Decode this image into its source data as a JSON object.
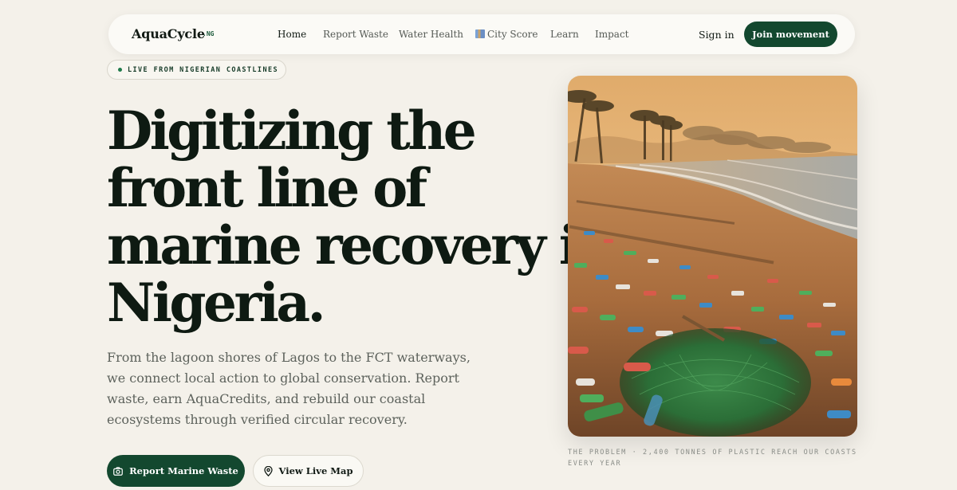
{
  "nav": {
    "logo": "AquaCycle",
    "logo_suffix": ".NG",
    "links": [
      {
        "label": "Home",
        "active": true
      },
      {
        "label": "Report Waste"
      },
      {
        "label": "Water Health"
      },
      {
        "label": "City Score",
        "icon": "cityscape-icon"
      },
      {
        "label": "Learn"
      },
      {
        "label": "Impact"
      }
    ],
    "signin": "Sign in",
    "cta": "Join movement"
  },
  "hero": {
    "badge": "LIVE FROM NIGERIAN COASTLINES",
    "headline": [
      "Digitizing the",
      "front line of",
      "marine recovery in",
      "Nigeria."
    ],
    "description": "From the lagoon shores of Lagos to the FCT waterways, we connect local action to global conservation. Report waste, earn AquaCredits, and rebuild our coastal ecosystems through verified circular recovery.",
    "primary_button": "Report Marine Waste",
    "primary_icon": "camera-icon",
    "secondary_button": "View Live Map",
    "secondary_icon": "map-pin-icon"
  },
  "image": {
    "caption": "THE PROBLEM · 2,400 TONNES OF PLASTIC REACH OUR COASTS EVERY YEAR"
  },
  "colors": {
    "background": "#f4f1ea",
    "brand_green": "#13482f",
    "text_dark": "#0e1a12",
    "text_muted": "#5d625c"
  }
}
